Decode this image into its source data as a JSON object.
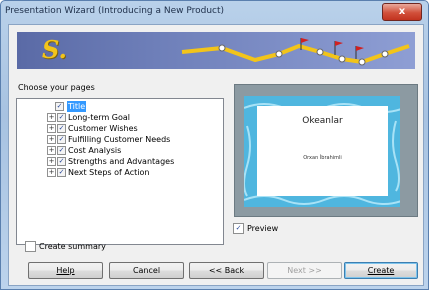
{
  "window": {
    "title": "Presentation Wizard (Introducing a New Product)",
    "close_glyph": "x"
  },
  "banner": {
    "logo_text": "S."
  },
  "pages_section": {
    "label": "Choose your pages",
    "items": [
      {
        "label": "Title",
        "checked": true,
        "selected": true,
        "expandable": false
      },
      {
        "label": "Long-term Goal",
        "checked": true,
        "selected": false,
        "expandable": true
      },
      {
        "label": "Customer Wishes",
        "checked": true,
        "selected": false,
        "expandable": true
      },
      {
        "label": "Fulfilling Customer Needs",
        "checked": true,
        "selected": false,
        "expandable": true
      },
      {
        "label": "Cost Analysis",
        "checked": true,
        "selected": false,
        "expandable": true
      },
      {
        "label": "Strengths and Advantages",
        "checked": true,
        "selected": false,
        "expandable": true
      },
      {
        "label": "Next Steps of Action",
        "checked": true,
        "selected": false,
        "expandable": true
      }
    ]
  },
  "preview": {
    "slide_title": "Okeanlar",
    "slide_subtitle": "Orxan İbrahimli",
    "checkbox_label": "Preview",
    "checked": true
  },
  "create_summary": {
    "label": "Create summary",
    "checked": false
  },
  "buttons": {
    "help": "Help",
    "cancel": "Cancel",
    "back": "<< Back",
    "next": "Next >>",
    "create": "Create"
  },
  "colors": {
    "banner_bg": "#6e7fb9",
    "banner_line": "#f2c41a",
    "selection": "#3399ff",
    "slide_bg": "#4fb6df"
  }
}
